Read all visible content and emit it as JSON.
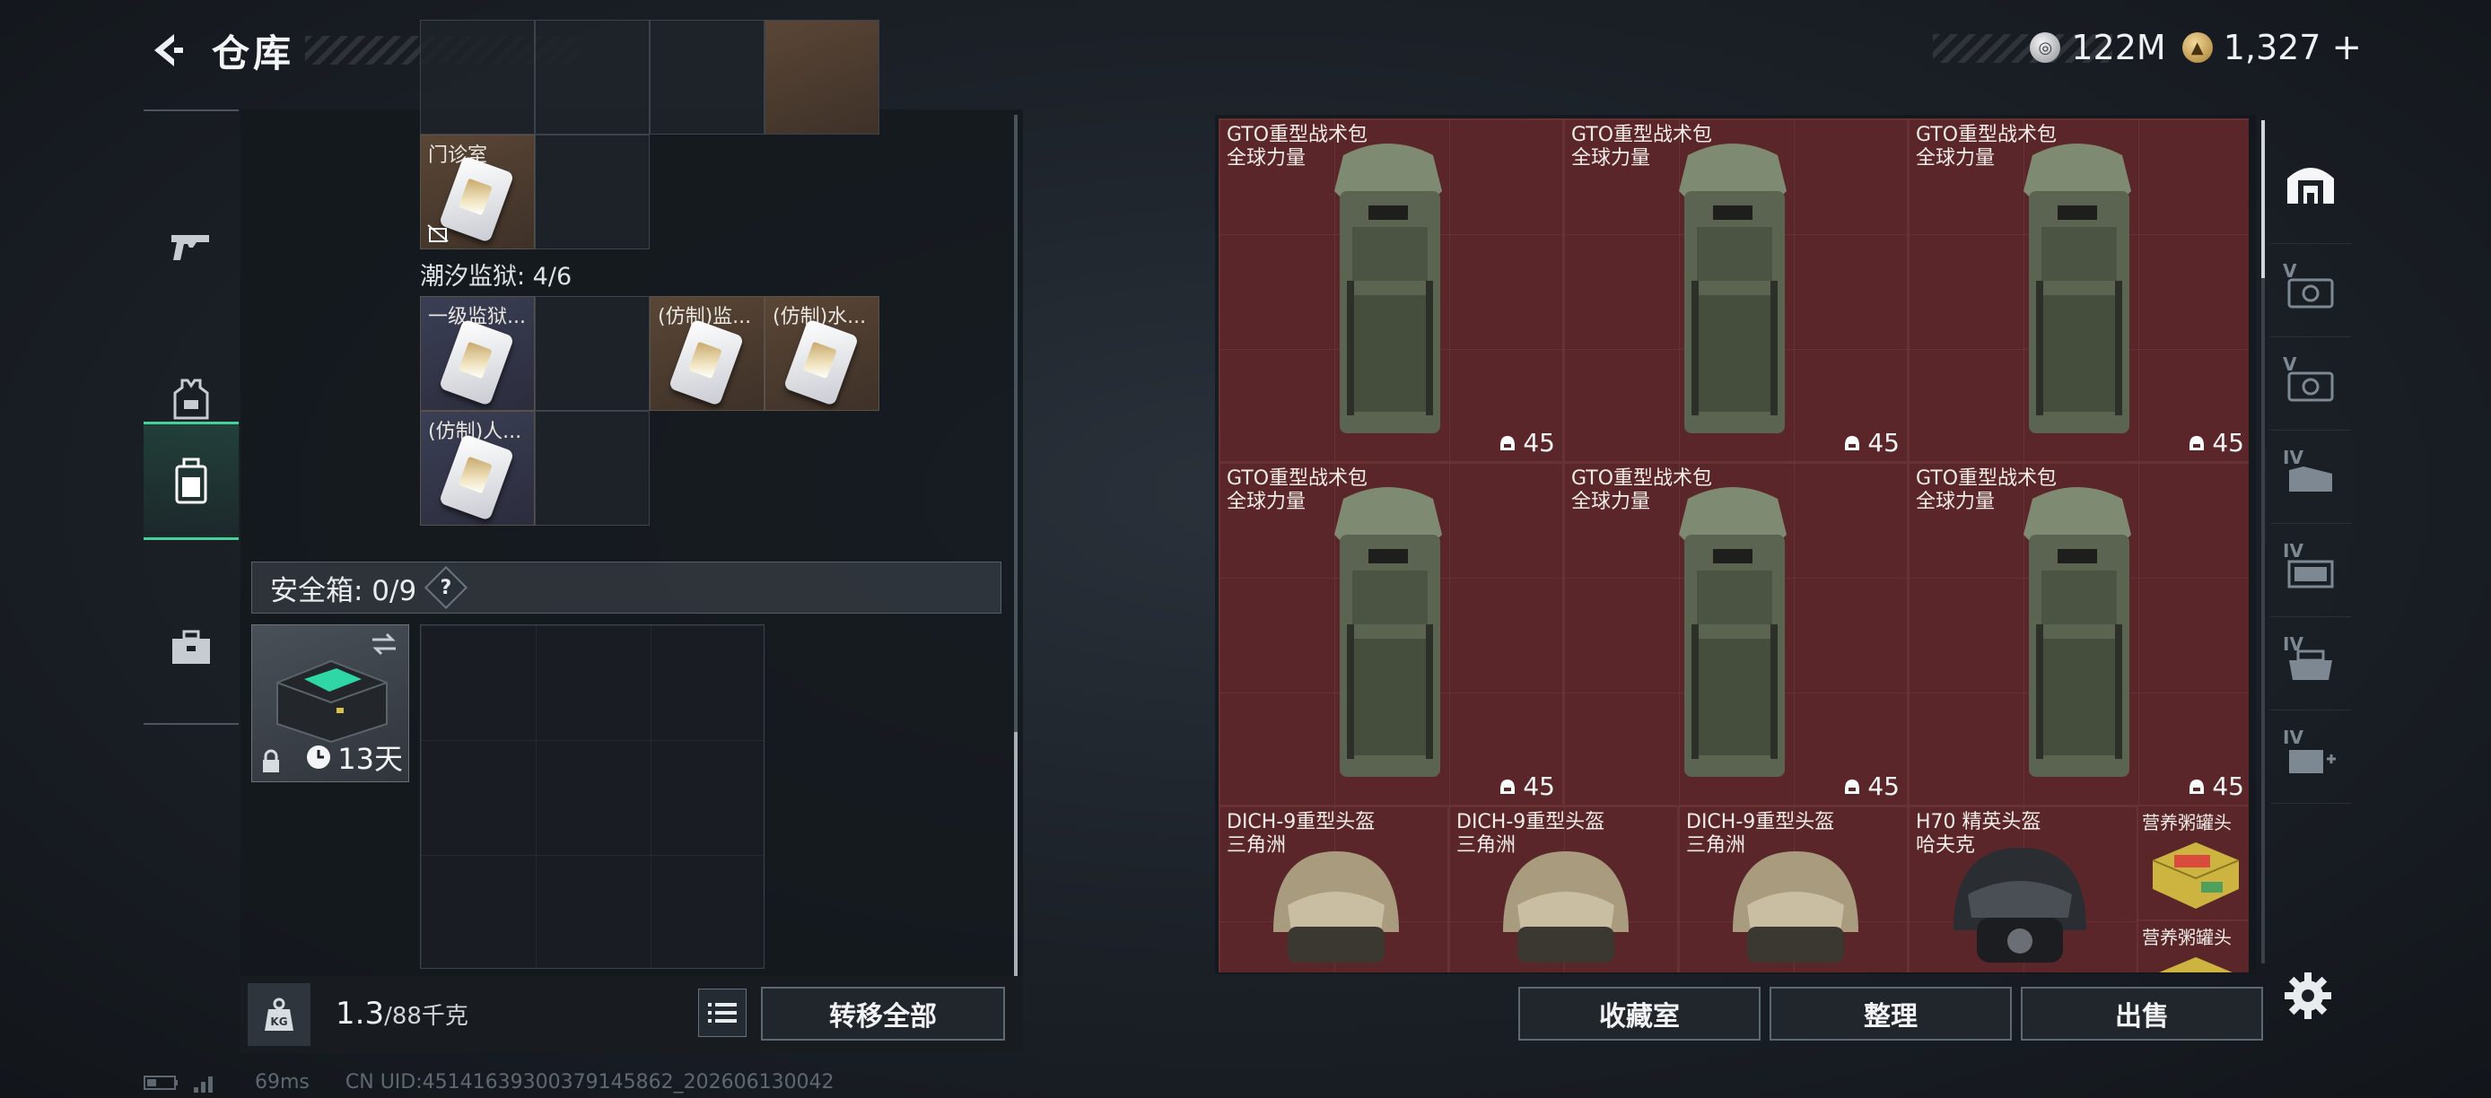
{
  "header": {
    "title": "仓库",
    "currencies": [
      {
        "icon": "silver-coin-icon",
        "value": "122M"
      },
      {
        "icon": "gold-coin-icon",
        "value": "1,327"
      }
    ],
    "add_symbol": "+"
  },
  "left_nav": [
    {
      "icon": "gun-icon",
      "active": false
    },
    {
      "icon": "armor-vest-icon",
      "active": false
    },
    {
      "icon": "backpack-icon",
      "active": true
    },
    {
      "icon": "toolbox-icon",
      "active": false
    }
  ],
  "container": {
    "items_top": [
      {
        "name": "门诊室",
        "type": "keycard",
        "bg": "brown"
      }
    ],
    "section_label": "潮汐监狱: 4/6",
    "section_items": [
      {
        "name": "一级监狱...",
        "bg": "slate"
      },
      {
        "name": "(仿制)监...",
        "bg": "brown"
      },
      {
        "name": "(仿制)水...",
        "bg": "brown"
      },
      {
        "name": "(仿制)人...",
        "bg": "slate"
      }
    ]
  },
  "safe_box": {
    "label": "安全箱: 0/9",
    "help": "?",
    "timer": "13天"
  },
  "footer_left": {
    "weight": "1.3",
    "weight_max": "/88千克",
    "weight_icon_label": "KG",
    "transfer_all": "转移全部"
  },
  "stash": {
    "backpacks": [
      {
        "name": "GTO重型战术包",
        "sub": "全球力量",
        "durability": "45"
      },
      {
        "name": "GTO重型战术包",
        "sub": "全球力量",
        "durability": "45"
      },
      {
        "name": "GTO重型战术包",
        "sub": "全球力量",
        "durability": "45"
      },
      {
        "name": "GTO重型战术包",
        "sub": "全球力量",
        "durability": "45"
      },
      {
        "name": "GTO重型战术包",
        "sub": "全球力量",
        "durability": "45"
      },
      {
        "name": "GTO重型战术包",
        "sub": "全球力量",
        "durability": "45"
      }
    ],
    "helmets": [
      {
        "name": "DICH-9重型头盔",
        "sub": "三角洲"
      },
      {
        "name": "DICH-9重型头盔",
        "sub": "三角洲"
      },
      {
        "name": "DICH-9重型头盔",
        "sub": "三角洲"
      },
      {
        "name": "H70 精英头盔",
        "sub": "哈夫克"
      }
    ],
    "food": [
      {
        "name": "营养粥罐头"
      },
      {
        "name": "营养粥罐头"
      }
    ]
  },
  "footer_right": {
    "collection": "收藏室",
    "organize": "整理",
    "sell": "出售"
  },
  "right_nav": [
    {
      "icon": "home-icon",
      "level": ""
    },
    {
      "icon": "v-case-icon",
      "level": "V"
    },
    {
      "icon": "v-case-icon",
      "level": "V"
    },
    {
      "icon": "iv-case-icon",
      "level": "IV"
    },
    {
      "icon": "iv-case-icon",
      "level": "IV"
    },
    {
      "icon": "iv-case-icon",
      "level": "IV"
    },
    {
      "icon": "iv-add-icon",
      "level": "IV"
    }
  ],
  "status_bar": {
    "ping": "69ms",
    "uid": "CN UID:45141639300379145862_202606130042"
  }
}
